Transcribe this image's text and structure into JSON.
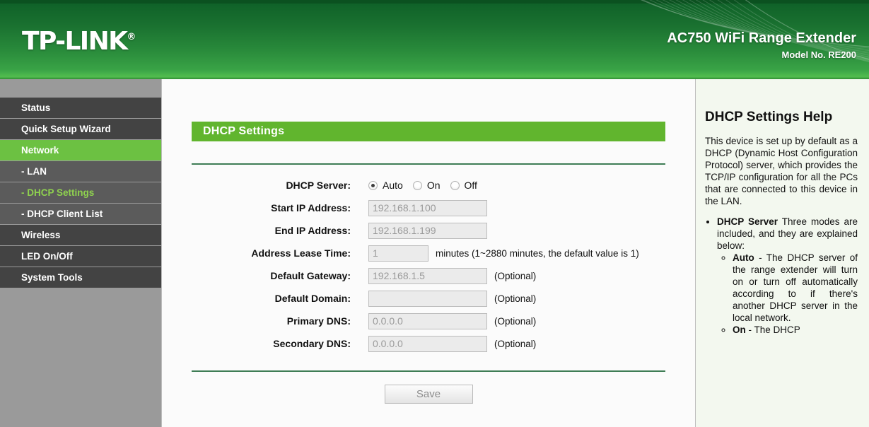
{
  "header": {
    "logo": "TP-LINK",
    "logo_registered": "®",
    "product": "AC750 WiFi Range Extender",
    "model": "Model No. RE200"
  },
  "sidebar": {
    "items": [
      {
        "label": "Status",
        "state": "normal"
      },
      {
        "label": "Quick Setup Wizard",
        "state": "normal"
      },
      {
        "label": "Network",
        "state": "active-parent"
      },
      {
        "label": "- LAN",
        "state": "sub"
      },
      {
        "label": "- DHCP Settings",
        "state": "active-sub"
      },
      {
        "label": "- DHCP Client List",
        "state": "sub"
      },
      {
        "label": "Wireless",
        "state": "normal"
      },
      {
        "label": "LED On/Off",
        "state": "normal"
      },
      {
        "label": "System Tools",
        "state": "normal"
      }
    ]
  },
  "main": {
    "section_title": "DHCP Settings",
    "dhcp_server": {
      "label": "DHCP Server:",
      "options": [
        {
          "label": "Auto",
          "checked": true
        },
        {
          "label": "On",
          "checked": false
        },
        {
          "label": "Off",
          "checked": false
        }
      ]
    },
    "fields": {
      "start_ip": {
        "label": "Start IP Address:",
        "value": "192.168.1.100",
        "suffix": ""
      },
      "end_ip": {
        "label": "End IP Address:",
        "value": "192.168.1.199",
        "suffix": ""
      },
      "lease_time": {
        "label": "Address Lease Time:",
        "value": "1",
        "suffix": "minutes (1~2880 minutes, the default value is 1)"
      },
      "gateway": {
        "label": "Default Gateway:",
        "value": "192.168.1.5",
        "suffix": "(Optional)"
      },
      "domain": {
        "label": "Default Domain:",
        "value": "",
        "suffix": "(Optional)"
      },
      "primary_dns": {
        "label": "Primary DNS:",
        "value": "0.0.0.0",
        "suffix": "(Optional)"
      },
      "secondary_dns": {
        "label": "Secondary DNS:",
        "value": "0.0.0.0",
        "suffix": "(Optional)"
      }
    },
    "save_label": "Save"
  },
  "help": {
    "title": "DHCP Settings Help",
    "intro": "This device is set up by default as a DHCP (Dynamic Host Configuration Protocol) server, which provides the TCP/IP configuration for all the PCs that are connected to this device in the LAN.",
    "bullet_term": "DHCP Server",
    "bullet_text": " Three modes are included, and they are explained below:",
    "sub_term": "Auto",
    "sub_text": " - The DHCP server of the range extender will turn on or turn off automatically according to if there's another DHCP server in the local network.",
    "sub_term2": "On",
    "sub_text2": " - The DHCP"
  },
  "colors": {
    "brand_green": "#61b52e",
    "header_dark_green": "#0d5c25",
    "sidebar_dark": "#434343",
    "sidebar_sub": "#5b5b5b",
    "active_green": "#6cc142",
    "help_bg": "#f3f8ef"
  }
}
